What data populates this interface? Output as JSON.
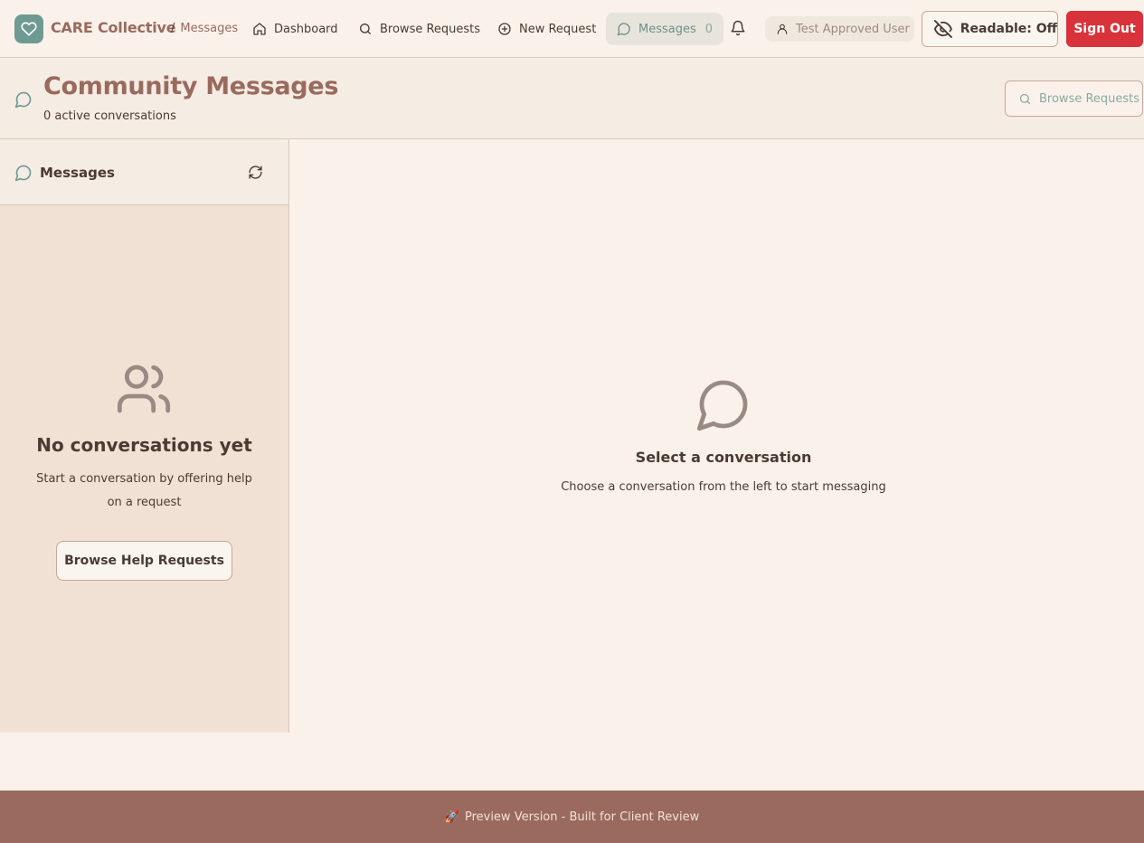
{
  "nav": {
    "brand": "CARE Collective",
    "breadcrumb_sep": "/",
    "breadcrumb": "Messages",
    "links": {
      "dashboard": "Dashboard",
      "browse": "Browse Requests",
      "new_request": "New Request",
      "messages": "Messages",
      "messages_count": "0"
    },
    "user": "Test Approved User",
    "readable": "Readable: Off",
    "sign_out": "Sign Out"
  },
  "header": {
    "title": "Community Messages",
    "subtitle": "0 active conversations",
    "browse_button": "Browse Requests"
  },
  "sidebar": {
    "title": "Messages",
    "empty_title": "No conversations yet",
    "empty_desc": "Start a conversation by offering help on a request",
    "browse_button": "Browse Help Requests"
  },
  "main": {
    "title": "Select a conversation",
    "desc": "Choose a conversation from the left to start messaging"
  },
  "footer": {
    "icon": "🚀",
    "text": "Preview Version - Built for Client Review"
  },
  "icons": {
    "logo": "heart-icon",
    "dashboard": "home-icon",
    "browse": "search-icon",
    "new_request": "plus-circle-icon",
    "messages": "message-circle-icon",
    "notifications": "bell-icon",
    "user": "user-icon",
    "readable": "eye-off-icon",
    "refresh": "refresh-icon",
    "empty_sidebar": "users-icon"
  },
  "colors": {
    "brand": "#9a6a5e",
    "accent": "#6f9a93",
    "danger": "#d8333a",
    "background": "#faf2ea"
  }
}
